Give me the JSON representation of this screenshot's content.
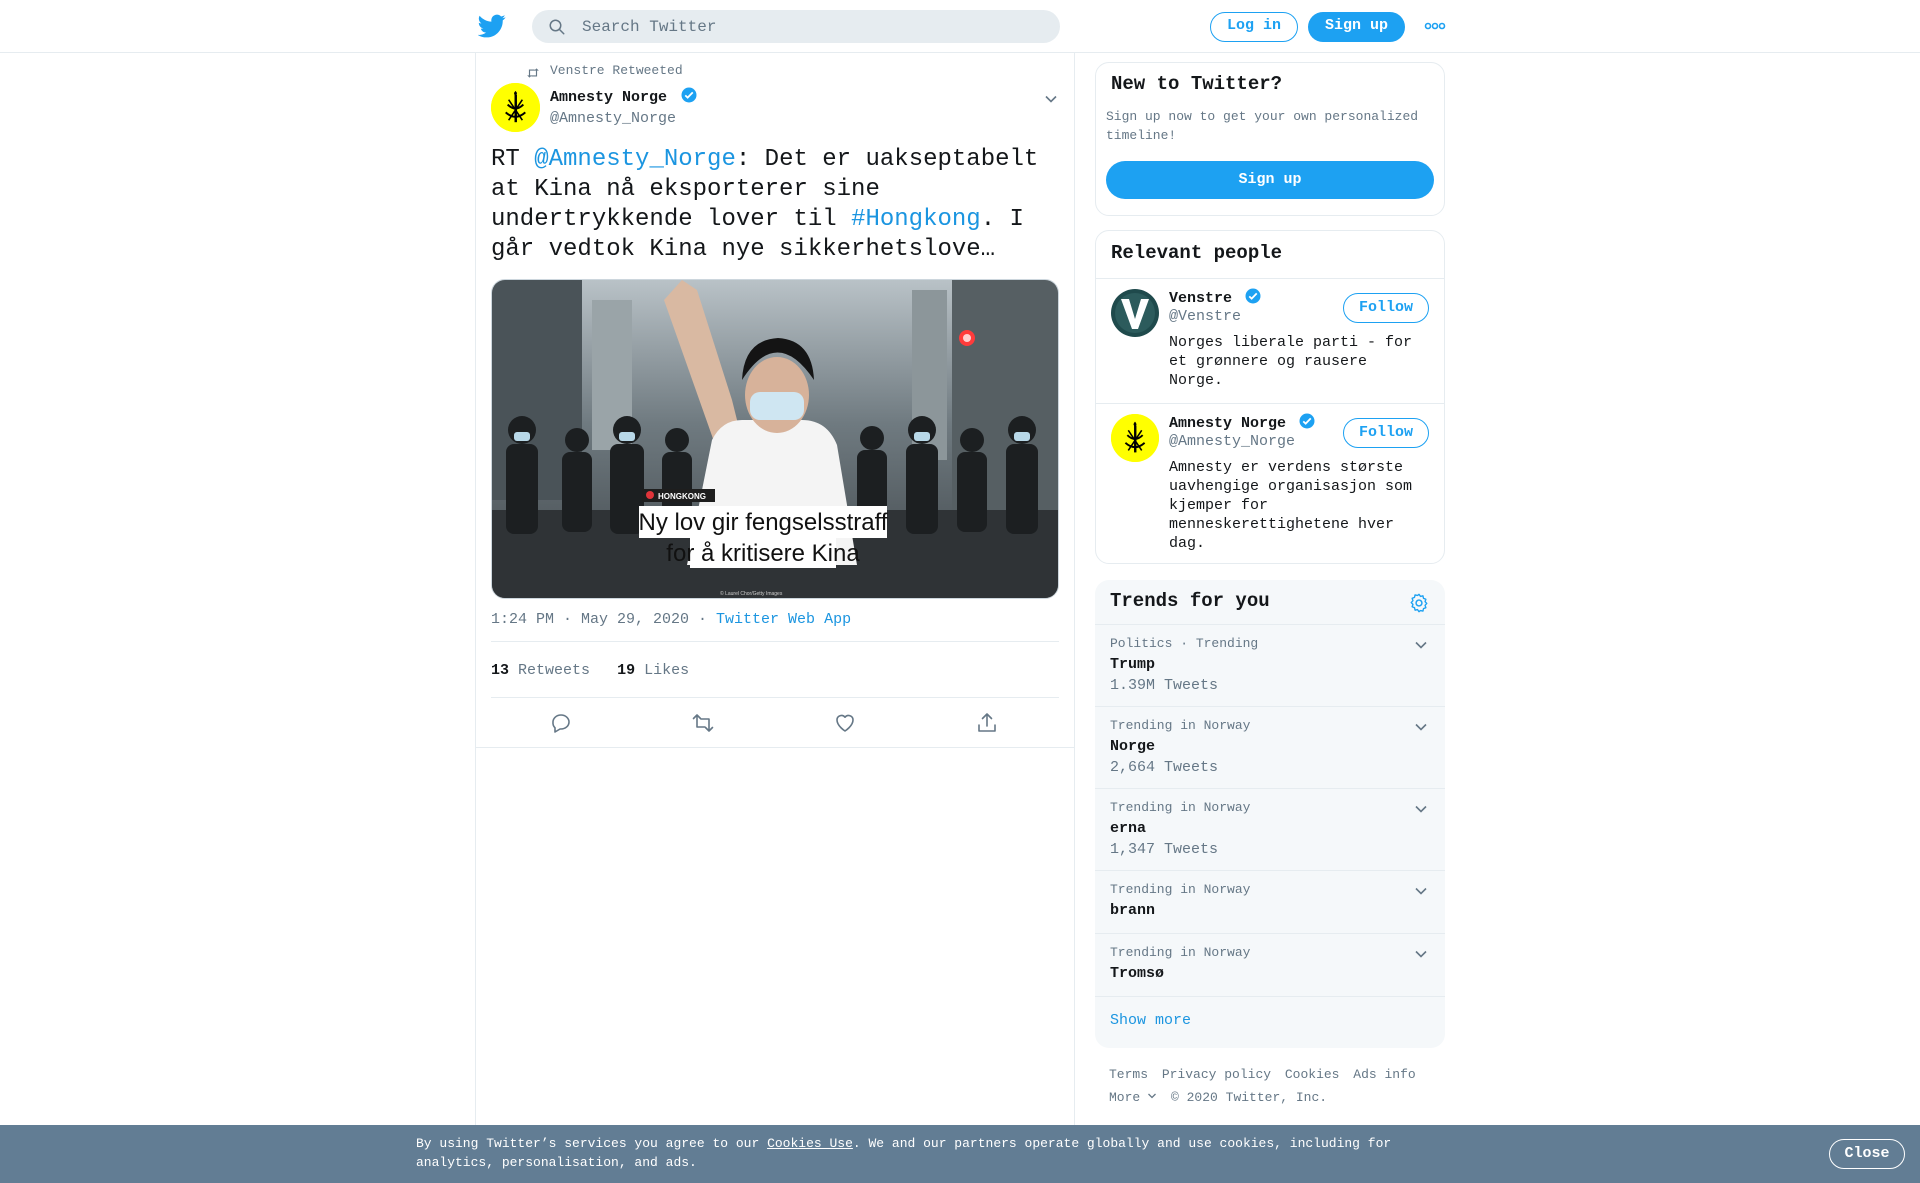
{
  "header": {
    "search_placeholder": "Search Twitter",
    "login_label": "Log in",
    "signup_label": "Sign up"
  },
  "tweet": {
    "retweeted_by": "Venstre Retweeted",
    "author_name": "Amnesty Norge",
    "author_handle": "@Amnesty_Norge",
    "text_prefix": "RT ",
    "mention": "@Amnesty_Norge",
    "text_mid": ": Det er uakseptabelt at Kina nå eksporterer sine undertrykkende lover til ",
    "hashtag": "#Hongkong",
    "text_suffix": ". I går vedtok Kina nye sikkerhetslove…",
    "media": {
      "tag": "HONGKONG",
      "headline_line1": "Ny lov gir fengselsstraff",
      "headline_line2": "for å kritisere Kina",
      "credit": "© Laurel Chor/Getty Images"
    },
    "timestamp": "1:24 PM · May 29, 2020 · ",
    "source_app": "Twitter Web App",
    "retweets_count": "13",
    "retweets_label": "Retweets",
    "likes_count": "19",
    "likes_label": "Likes"
  },
  "new_to_twitter": {
    "title": "New to Twitter?",
    "text": "Sign up now to get your own personalized timeline!",
    "button": "Sign up"
  },
  "relevant_people": {
    "title": "Relevant people",
    "people": [
      {
        "name": "Venstre",
        "handle": "@Venstre",
        "bio": "Norges liberale parti - for et grønnere og rausere Norge.",
        "follow_label": "Follow"
      },
      {
        "name": "Amnesty Norge",
        "handle": "@Amnesty_Norge",
        "bio": "Amnesty er verdens største uavhengige organisasjon som kjemper for menneskerettighetene hver dag.",
        "follow_label": "Follow"
      }
    ]
  },
  "trends": {
    "title": "Trends for you",
    "items": [
      {
        "context": "Politics · Trending",
        "name": "Trump",
        "count": "1.39M Tweets"
      },
      {
        "context": "Trending in Norway",
        "name": "Norge",
        "count": "2,664 Tweets"
      },
      {
        "context": "Trending in Norway",
        "name": "erna",
        "count": "1,347 Tweets"
      },
      {
        "context": "Trending in Norway",
        "name": "brann",
        "count": ""
      },
      {
        "context": "Trending in Norway",
        "name": "Tromsø",
        "count": ""
      }
    ],
    "show_more": "Show more"
  },
  "footer": {
    "links": [
      "Terms",
      "Privacy policy",
      "Cookies",
      "Ads info"
    ],
    "more": "More",
    "copyright": "© 2020 Twitter, Inc."
  },
  "cookie_banner": {
    "text_before": "By using Twitter’s services you agree to our ",
    "link": "Cookies Use",
    "text_after": ". We and our partners operate globally and use cookies, including for analytics, personalisation, and ads.",
    "close_label": "Close"
  },
  "colors": {
    "brand_blue": "#1da1f2",
    "link_blue": "#1b95e0",
    "secondary_text": "#657786",
    "cookie_bg": "#627d94",
    "amnesty_yellow": "#ffff00"
  }
}
